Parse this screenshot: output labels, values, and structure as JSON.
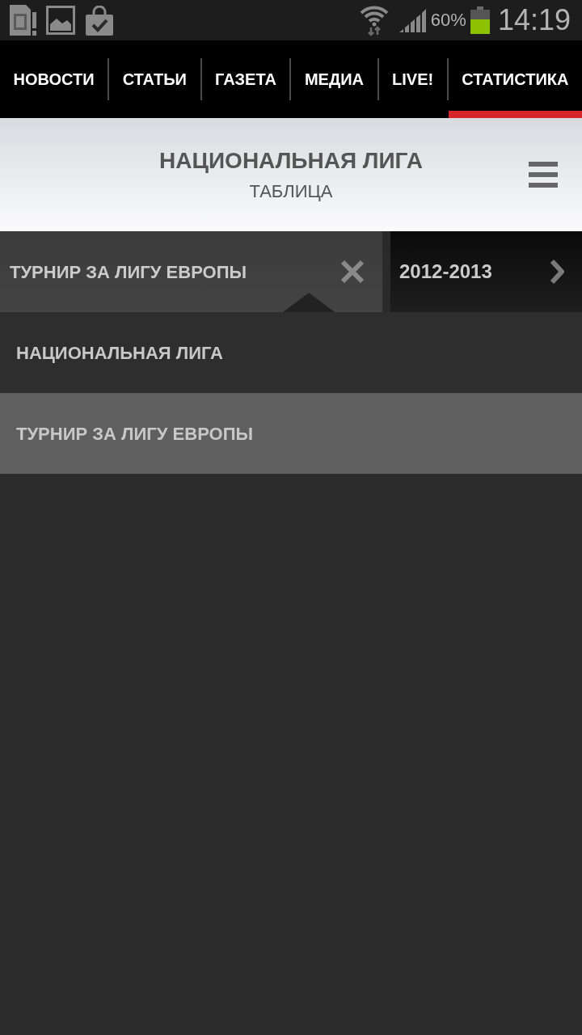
{
  "status_bar": {
    "battery_percent": "60%",
    "time": "14:19"
  },
  "nav_tabs": [
    {
      "label": "НОВОСТИ",
      "selected": false
    },
    {
      "label": "СТАТЬИ",
      "selected": false
    },
    {
      "label": "ГАЗЕТА",
      "selected": false
    },
    {
      "label": "МЕДИА",
      "selected": false
    },
    {
      "label": "LIVE!",
      "selected": false
    },
    {
      "label": "СТАТИСТИКА",
      "selected": true
    }
  ],
  "header": {
    "title": "НАЦИОНАЛЬНАЯ ЛИГА",
    "subtitle": "ТАБЛИЦА"
  },
  "filter_bar": {
    "tournament": "ТУРНИР ЗА ЛИГУ ЕВРОПЫ",
    "expanded": true,
    "season": "2012-2013"
  },
  "dropdown": {
    "items": [
      {
        "label": "НАЦИОНАЛЬНАЯ ЛИГА",
        "selected": false
      },
      {
        "label": "ТУРНИР ЗА ЛИГУ ЕВРОПЫ",
        "selected": true
      }
    ]
  }
}
